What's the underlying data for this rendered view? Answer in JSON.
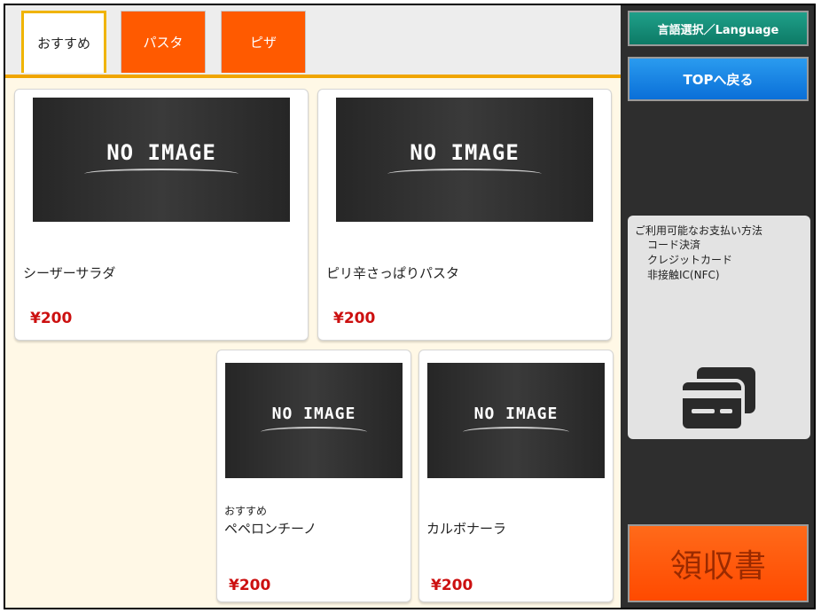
{
  "tabs": [
    {
      "label": "おすすめ",
      "active": true
    },
    {
      "label": "パスタ",
      "active": false
    },
    {
      "label": "ピザ",
      "active": false
    }
  ],
  "products": [
    {
      "image_text": "NO IMAGE",
      "tag": "",
      "name": "シーザーサラダ",
      "price": "¥200"
    },
    {
      "image_text": "NO IMAGE",
      "tag": "",
      "name": "ピリ辛さっぱりパスタ",
      "price": "¥200"
    },
    {
      "image_text": "NO IMAGE",
      "tag": "おすすめ",
      "name": "ペペロンチーノ",
      "price": "¥200"
    },
    {
      "image_text": "NO IMAGE",
      "tag": "",
      "name": "カルボナーラ",
      "price": "¥200"
    }
  ],
  "sidebar": {
    "language_button": "言語選択／Language",
    "top_button": "TOPへ戻る",
    "payment": {
      "title": "ご利用可能なお支払い方法",
      "methods": [
        "コード決済",
        "クレジットカード",
        "非接触IC(NFC)"
      ],
      "icon": "payment-card-icon"
    },
    "receipt_button": "領収書"
  },
  "colors": {
    "tab_orange": "#ff5a00",
    "tab_active_border": "#f0b400",
    "price_red": "#cc1010",
    "language_green": "#0d7a66",
    "top_blue": "#0a6fd8",
    "receipt_orange": "#ff4a00",
    "sidebar_bg": "#2e2e2e",
    "content_bg": "#fff8e6"
  }
}
